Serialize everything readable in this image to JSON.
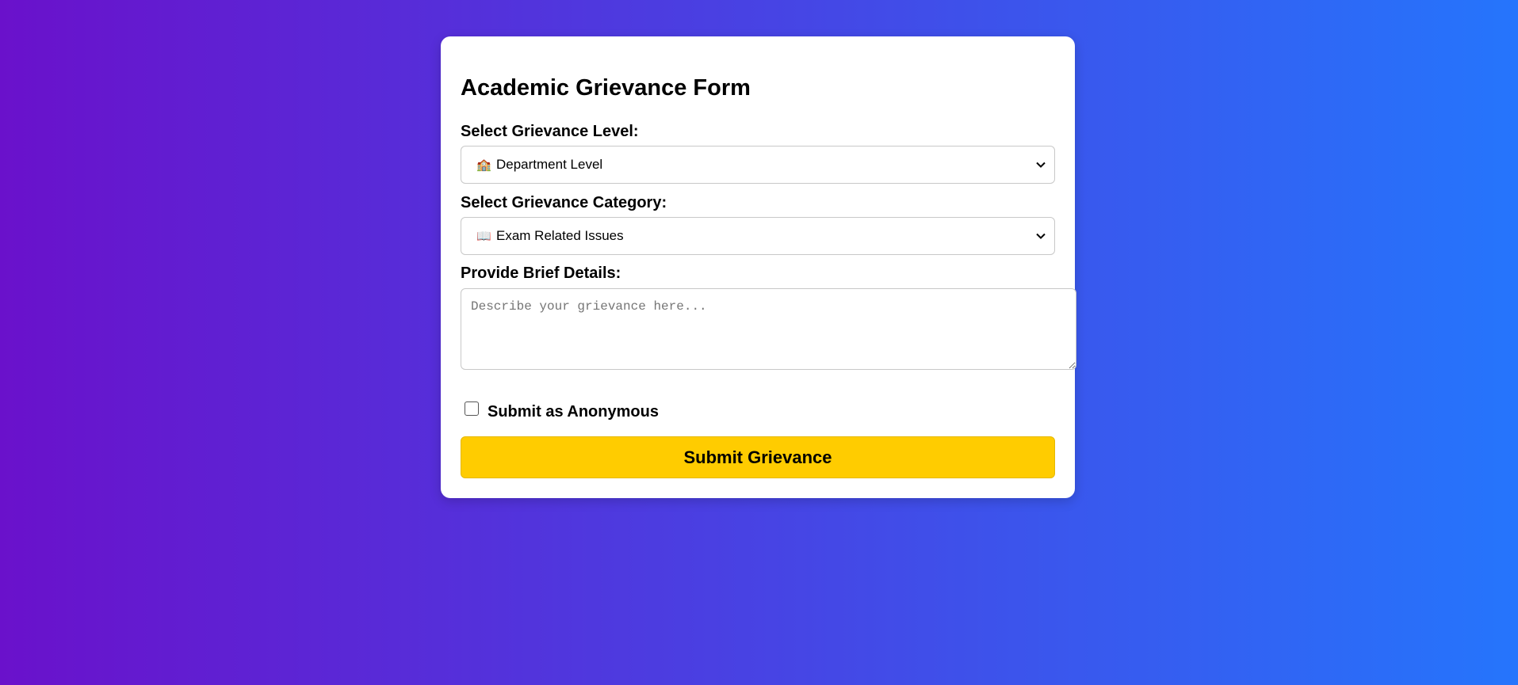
{
  "form": {
    "title": "Academic Grievance Form",
    "level_label": "Select Grievance Level:",
    "level_selected": {
      "icon": "school-building-icon",
      "emoji": "🏫",
      "text": "Department Level"
    },
    "category_label": "Select Grievance Category:",
    "category_selected": {
      "icon": "open-book-icon",
      "emoji": "📖",
      "text": "Exam Related Issues"
    },
    "details_label": "Provide Brief Details:",
    "details_placeholder": "Describe your grievance here...",
    "details_value": "",
    "anonymous_label": "Submit as Anonymous",
    "anonymous_checked": false,
    "submit_label": "Submit Grievance"
  },
  "colors": {
    "gradient_start": "#6a11cb",
    "gradient_end": "#2575fc",
    "card_bg": "#ffffff",
    "submit_bg": "#ffcc00"
  }
}
